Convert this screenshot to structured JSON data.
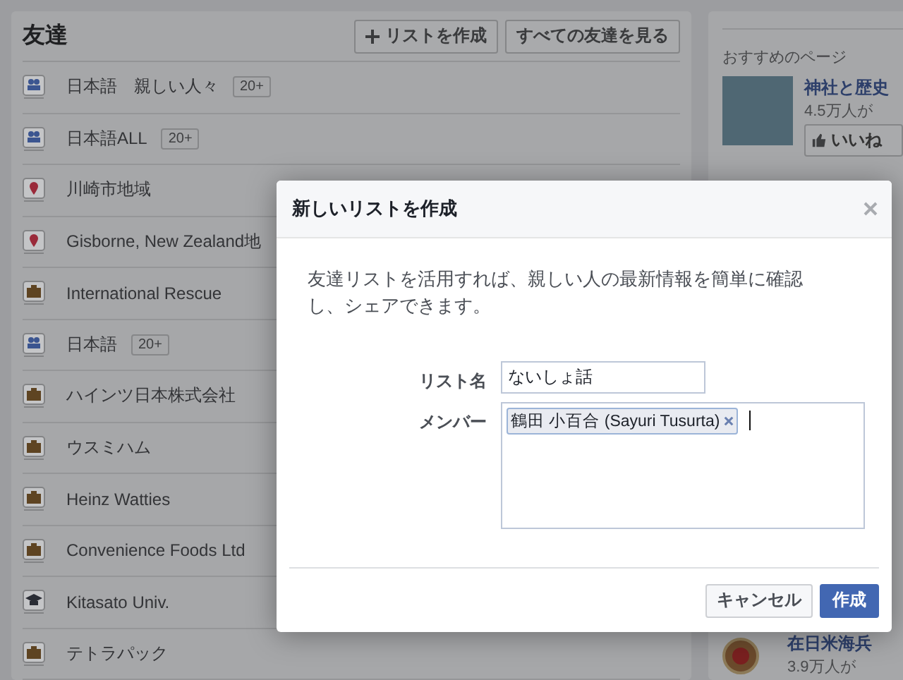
{
  "friends_panel": {
    "title": "友達",
    "buttons": [
      {
        "label": "リストを作成",
        "kind": "create"
      },
      {
        "label": "すべての友達を見る",
        "kind": "view"
      }
    ],
    "lists": [
      {
        "kind": "group",
        "name": "日本語　親しい人々",
        "badge": "20+"
      },
      {
        "kind": "group",
        "name": "日本語ALL",
        "badge": "20+"
      },
      {
        "kind": "place",
        "name": "川崎市地域"
      },
      {
        "kind": "place",
        "name": "Gisborne, New Zealand地"
      },
      {
        "kind": "work",
        "name": "International Rescue"
      },
      {
        "kind": "group",
        "name": "日本語",
        "badge": "20+"
      },
      {
        "kind": "work",
        "name": "ハインツ日本株式会社"
      },
      {
        "kind": "work",
        "name": "ウスミハム"
      },
      {
        "kind": "work",
        "name": "Heinz Watties"
      },
      {
        "kind": "work",
        "name": "Convenience Foods Ltd"
      },
      {
        "kind": "school",
        "name": "Kitasato Univ."
      },
      {
        "kind": "work",
        "name": "テトラパック"
      }
    ]
  },
  "suggested_pages": {
    "heading": "おすすめのページ",
    "pages": [
      {
        "kind": "photo",
        "name": "神社と歴史",
        "likes": "4.5万人が",
        "like_button": "いいね"
      },
      {
        "kind": "emblem",
        "name": "在日米海兵",
        "likes": "3.9万人が"
      }
    ]
  },
  "dialog": {
    "title": "新しいリストを作成",
    "description": "友達リストを活用すれば、親しい人の最新情報を簡単に確認し、シェアできます。",
    "name_label": "リスト名",
    "name_value": "ないしょ話",
    "members_label": "メンバー",
    "members": [
      "鶴田 小百合 (Sayuri Tusurta)"
    ],
    "cancel": "キャンセル",
    "submit": "作成"
  }
}
